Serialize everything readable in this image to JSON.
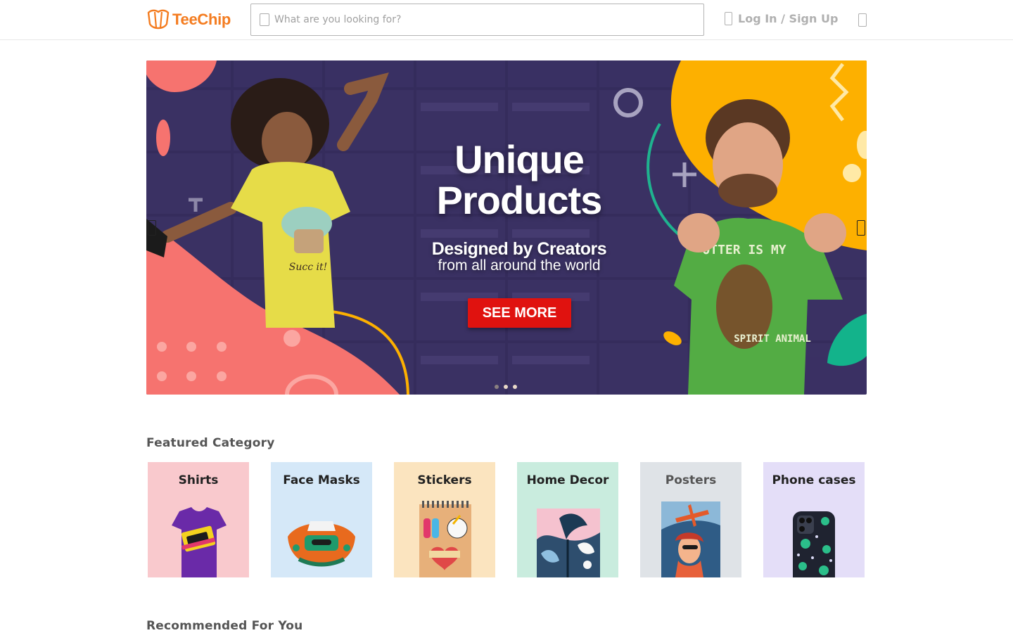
{
  "header": {
    "logo_text": "TeeChip",
    "search_placeholder": "What are you looking for?",
    "login_label": "Log In / Sign Up"
  },
  "hero": {
    "title_line1": "Unique",
    "title_line2": "Products",
    "subtitle1": "Designed by Creators",
    "subtitle2": "from all around the world",
    "cta_label": "SEE MORE",
    "slide_count": 3,
    "active_slide": 1,
    "shirt_left_text": "Succ it!",
    "shirt_right_text_top": "OTTER IS MY",
    "shirt_right_text_bottom": "SPIRIT ANIMAL"
  },
  "sections": {
    "featured_title": "Featured Category",
    "recommended_title": "Recommended For You"
  },
  "categories": [
    {
      "label": "Shirts",
      "bg": "#f9c9cd"
    },
    {
      "label": "Face Masks",
      "bg": "#d5e8f8"
    },
    {
      "label": "Stickers",
      "bg": "#fbe4bf"
    },
    {
      "label": "Home Decor",
      "bg": "#c9ecde"
    },
    {
      "label": "Posters",
      "bg": "#dfe3e7"
    },
    {
      "label": "Phone cases",
      "bg": "#e4def8"
    }
  ],
  "colors": {
    "brand": "#f47c20",
    "cta": "#e0120f",
    "hero_bg": "#3a3163",
    "coral": "#f6736f",
    "yellow": "#fdb000",
    "green": "#4caf50"
  },
  "icons": {
    "search": "search-icon",
    "user": "user-icon",
    "cart": "cart-icon",
    "prev": "chevron-left-icon",
    "next": "chevron-right-icon"
  }
}
